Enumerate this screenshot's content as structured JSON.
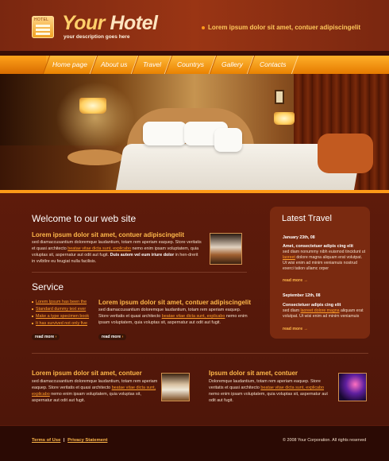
{
  "header": {
    "logo_text": "HOTEL",
    "brand_first": "Your",
    "brand_second": " Hotel",
    "tagline": "your description goes here",
    "quote": "Lorem ipsum dolor sit amet, contuer adipiscingelit"
  },
  "nav": {
    "items": [
      {
        "label": "Home page"
      },
      {
        "label": "About us"
      },
      {
        "label": "Travel"
      },
      {
        "label": "Countrys"
      },
      {
        "label": "Gallery"
      },
      {
        "label": "Contacts"
      }
    ]
  },
  "welcome": {
    "title": "Welcome to our web site",
    "subtitle": "Lorem ipsum dolor sit amet, contuer adipiscingelit",
    "text_1": "sed diamaccusantium doloremque laudantium, totam rem aperiam eaquep. Store veritatis et quasi architecto ",
    "link": "beatae vitae dicta sunt, explicabo",
    "text_2": " nemo enim ipsam voluptatem, quia voluptas sit, aspernatur aut odit aut fugit. ",
    "bold": "Duis autem vel eum iriure dolor",
    "text_3": " in hen-drerit in vvlbtlre eu feugiat nulla facilisis."
  },
  "service": {
    "title": "Service",
    "list": [
      "Lorem Ipsum has been the",
      "Standard dummy text ever",
      "Make a type specimen book",
      "It has survived not only five"
    ],
    "subtitle": "Lorem ipsum dolor sit amet, contuer adipiscingelit",
    "text_1": "sed diamaccusantium doloremque laudantium, totam rem aperiam eaquep. Store veritatis et quasi architecto ",
    "link": "beatae vitae dicta sunt, explicabo",
    "text_2": " nemo enim ipsam voluptatem, quia voluptas sit, aspernatur aut odit aut fugit.",
    "read_more": "read more"
  },
  "latest": {
    "title": "Latest Travel",
    "items": [
      {
        "date": "January 23th, 08",
        "head": "Amet, consectetuer adipis cing elit",
        "text_1": "sed diam nonummy nibh euismod tincidunt ut ",
        "link": "laoreet",
        "text_2": " dolore magna aliquam erat volutpat.   Ut wisi enim ad minim veniamuis nostrud exerci tation ullamc orper",
        "more": "read more"
      },
      {
        "date": "September 12th, 08",
        "head": "Consectetuer adipis cing elit",
        "text_1": "sed diam ",
        "link": "laoreet dolore magna",
        "text_2": " aliquam erat volutpat.   Ut wisi enim ad minim veniamuis",
        "more": "read more"
      }
    ]
  },
  "bottom": {
    "left": {
      "subtitle": "Lorem ipsum dolor sit amet, contuer",
      "text_1": "sed diamaccusantium doloremque laudantium, totam rem aperiam eaquep.  Store veritatis et quasi architecto ",
      "link": "beatae vitae dicta sunt, explicabo",
      "text_2": " nemo enim ipsam voluptatem, quia voluptas sit, aspernatur aut odit aut fugit."
    },
    "right": {
      "subtitle": "Ipsum dolor sit amet, contuer",
      "text_1": "Doloremque laudantium, totam rem aperiam eaquep.  Store veritatis et quasi architecto ",
      "link": "beatae vitae dicta sunt, explicabo",
      "text_2": " nemo enim ipsam voluptatem, quia voluptas sit, aspernatur aut odit aut fugit."
    }
  },
  "footer": {
    "terms": "Terms of Use",
    "separator": "|",
    "privacy": "Privacy Statement",
    "copyright": "© 2008 Your Corporation. All rights reserved"
  },
  "colors": {
    "background": "#5a1a0c",
    "accent": "#ff9a18",
    "heading_accent": "#ffb84a",
    "footer": "#2b0a04"
  }
}
